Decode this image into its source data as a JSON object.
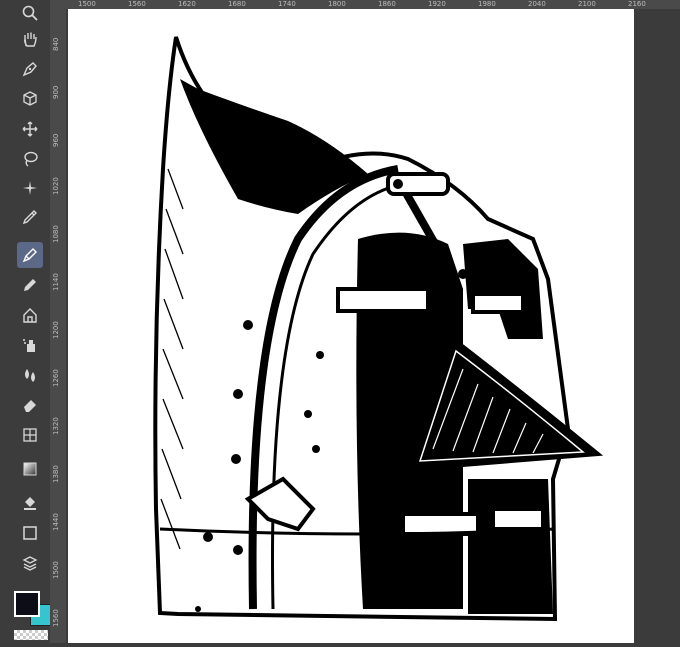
{
  "ruler": {
    "top_ticks": [
      "1500",
      "1560",
      "1620",
      "1680",
      "1740",
      "1800",
      "1860",
      "1920",
      "1980",
      "2040",
      "2100",
      "2160"
    ],
    "left_ticks": [
      "840",
      "900",
      "960",
      "1020",
      "1080",
      "1140",
      "1200",
      "1260",
      "1320",
      "1380",
      "1440",
      "1500",
      "1560"
    ]
  },
  "tools": [
    {
      "name": "zoom-tool",
      "icon": "magnifier-icon"
    },
    {
      "name": "hand-tool",
      "icon": "hand-icon"
    },
    {
      "name": "pen-tool",
      "icon": "pen-nib-icon"
    },
    {
      "name": "3d-tool",
      "icon": "cube-icon"
    },
    {
      "name": "move-tool",
      "icon": "move-arrows-icon"
    },
    {
      "name": "lasso-tool",
      "icon": "lasso-icon"
    },
    {
      "name": "magic-wand-tool",
      "icon": "sparkle-icon"
    },
    {
      "name": "eyedropper-tool",
      "icon": "eyedropper-icon"
    },
    {
      "name": "inking-pen-tool",
      "icon": "inking-pen-icon",
      "active": true
    },
    {
      "name": "pencil-tool",
      "icon": "pencil-icon"
    },
    {
      "name": "brush-tool",
      "icon": "house-brush-icon"
    },
    {
      "name": "airbrush-tool",
      "icon": "airbrush-icon"
    },
    {
      "name": "blend-tool",
      "icon": "droplets-icon"
    },
    {
      "name": "eraser-tool",
      "icon": "eraser-icon"
    },
    {
      "name": "frame-tool",
      "icon": "grid-frame-icon"
    },
    {
      "name": "gradient-tool",
      "icon": "gradient-icon"
    },
    {
      "name": "fill-tool",
      "icon": "fill-bucket-icon"
    },
    {
      "name": "shape-tool",
      "icon": "square-icon"
    },
    {
      "name": "text-tool",
      "icon": "layers-icon"
    }
  ],
  "colors": {
    "main_color": "#0d0d17",
    "sub_color": "#36c4cf",
    "active_tool_bg": "#5b6887"
  }
}
